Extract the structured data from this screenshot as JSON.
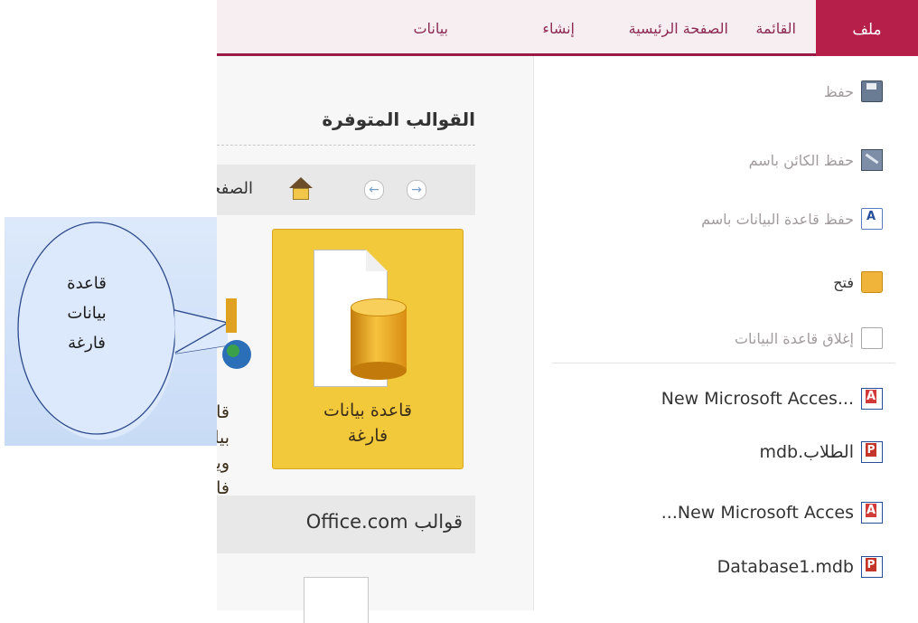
{
  "ribbon": {
    "tabs": {
      "file": "ملف",
      "list": "القائمة",
      "home": "الصفحة الرئيسية",
      "create": "إنشاء",
      "data": "بيانات"
    },
    "accent_color": "#b51f4a"
  },
  "menu": {
    "items": [
      {
        "label": "حفظ",
        "icon": "save-disk-icon"
      },
      {
        "label": "حفظ الكائن باسم",
        "icon": "save-object-as-icon"
      },
      {
        "label": "حفظ قاعدة البيانات باسم",
        "icon": "save-database-as-icon"
      },
      {
        "label": "فتح",
        "icon": "open-folder-icon"
      },
      {
        "label": "إغلاق قاعدة البيانات",
        "icon": "close-database-icon"
      }
    ],
    "recent": [
      {
        "label": "...New Microsoft Acces",
        "icon": "access-file-icon"
      },
      {
        "label": "الطلاب.mdb",
        "icon": "access-mdb-icon"
      },
      {
        "label": "New Microsoft Acces...",
        "icon": "access-file-icon"
      },
      {
        "label": "Database1.mdb",
        "icon": "access-mdb-icon"
      }
    ]
  },
  "templates": {
    "heading": "القوالب المتوفرة",
    "nav_home": "الصفحة الرئيسية",
    "blank_tile": {
      "line1": "قاعدة بيانات",
      "line2": "فارغة"
    },
    "web_tile": "قاعدة بيانات ويب فارغة",
    "office_bar": "قوالب Office.com"
  },
  "callout": {
    "line1": "قاعدة",
    "line2": "بيانات",
    "line3": "فارغة"
  }
}
